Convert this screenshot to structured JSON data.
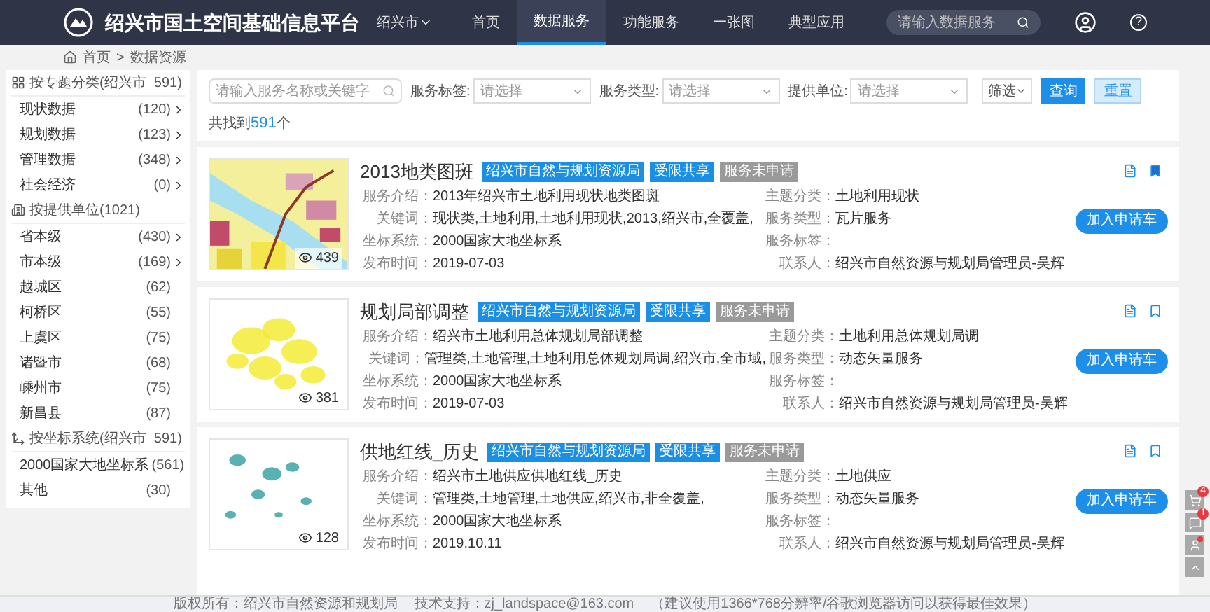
{
  "header": {
    "title": "绍兴市国土空间基础信息平台",
    "city": "绍兴市",
    "nav": [
      {
        "label": "首页",
        "selected": false
      },
      {
        "label": "数据服务",
        "selected": true
      },
      {
        "label": "功能服务",
        "selected": false
      },
      {
        "label": "一张图",
        "selected": false
      },
      {
        "label": "典型应用",
        "selected": false
      }
    ],
    "search": {
      "placeholder": "请输入数据服务"
    },
    "help": "?"
  },
  "breadcrumb": {
    "items": [
      "首页",
      "数据资源"
    ],
    "separator": ">"
  },
  "sidebar": {
    "groups": [
      {
        "kind": "grid",
        "title": "按专题分类(绍兴市  591)",
        "items": [
          {
            "label": "现状数据",
            "count": "(120)",
            "expandable": true
          },
          {
            "label": "规划数据",
            "count": "(123)",
            "expandable": true
          },
          {
            "label": "管理数据",
            "count": "(348)",
            "expandable": true
          },
          {
            "label": "社会经济",
            "count": "(0)",
            "expandable": true
          }
        ]
      },
      {
        "kind": "building",
        "title": "按提供单位(1021)",
        "items": [
          {
            "label": "省本级",
            "count": "(430)",
            "expandable": true
          },
          {
            "label": "市本级",
            "count": "(169)",
            "expandable": true
          },
          {
            "label": "越城区",
            "count": "(62)",
            "expandable": false
          },
          {
            "label": "柯桥区",
            "count": "(55)",
            "expandable": false
          },
          {
            "label": "上虞区",
            "count": "(75)",
            "expandable": false
          },
          {
            "label": "诸暨市",
            "count": "(68)",
            "expandable": false
          },
          {
            "label": "嵊州市",
            "count": "(75)",
            "expandable": false
          },
          {
            "label": "新昌县",
            "count": "(87)",
            "expandable": false
          }
        ]
      },
      {
        "kind": "axis",
        "title": "按坐标系统(绍兴市  591)",
        "items": [
          {
            "label": "2000国家大地坐标系",
            "count": "(561)",
            "expandable": false
          },
          {
            "label": "其他",
            "count": "(30)",
            "expandable": false
          }
        ]
      }
    ]
  },
  "filter": {
    "search_placeholder": "请输入服务名称或关键字",
    "selects": [
      {
        "label": "服务标签:",
        "placeholder": "请选择"
      },
      {
        "label": "服务类型:",
        "placeholder": "请选择"
      },
      {
        "label": "提供单位:",
        "placeholder": "请选择"
      }
    ],
    "screen_button": "筛选",
    "query_button": "查询",
    "reset_button": "重置"
  },
  "result_count": {
    "prefix": "共找到",
    "count": "591",
    "suffix": "个"
  },
  "cards": [
    {
      "title": "2013地类图斑",
      "badges": [
        {
          "text": "绍兴市自然与规划资源局",
          "kind": "org"
        },
        {
          "text": "受限共享",
          "kind": "share"
        },
        {
          "text": "服务未申请",
          "kind": "status"
        }
      ],
      "views": "439",
      "bookmarked": true,
      "fields_left": [
        {
          "label": "服务介绍：",
          "value": "2013年绍兴市土地利用现状地类图斑"
        },
        {
          "label": "关键词：",
          "value": "现状类,土地利用,土地利用现状,2013,绍兴市,全覆盖,"
        },
        {
          "label": "坐标系统：",
          "value": "2000国家大地坐标系"
        },
        {
          "label": "发布时间：",
          "value": "2019-07-03"
        }
      ],
      "fields_right": [
        {
          "label": "主题分类：",
          "value": "土地利用现状"
        },
        {
          "label": "服务类型：",
          "value": "瓦片服务"
        },
        {
          "label": "服务标签："
        },
        {
          "label": "联系人：",
          "value": "绍兴市自然资源与规划局管理员-吴辉"
        }
      ],
      "button": "加入申请车"
    },
    {
      "title": "规划局部调整",
      "badges": [
        {
          "text": "绍兴市自然与规划资源局",
          "kind": "org"
        },
        {
          "text": "受限共享",
          "kind": "share"
        },
        {
          "text": "服务未申请",
          "kind": "status"
        }
      ],
      "views": "381",
      "bookmarked": false,
      "fields_left": [
        {
          "label": "服务介绍：",
          "value": "绍兴市土地利用总体规划局部调整"
        },
        {
          "label": "关键词：",
          "value": "管理类,土地管理,土地利用总体规划局调,绍兴市,全市域,"
        },
        {
          "label": "坐标系统：",
          "value": "2000国家大地坐标系"
        },
        {
          "label": "发布时间：",
          "value": "2019-07-03"
        }
      ],
      "fields_right": [
        {
          "label": "主题分类：",
          "value": "土地利用总体规划局调"
        },
        {
          "label": "服务类型：",
          "value": "动态矢量服务"
        },
        {
          "label": "服务标签："
        },
        {
          "label": "联系人：",
          "value": "绍兴市自然资源与规划局管理员-吴辉"
        }
      ],
      "button": "加入申请车"
    },
    {
      "title": "供地红线_历史",
      "badges": [
        {
          "text": "绍兴市自然与规划资源局",
          "kind": "org"
        },
        {
          "text": "受限共享",
          "kind": "share"
        },
        {
          "text": "服务未申请",
          "kind": "status"
        }
      ],
      "views": "128",
      "bookmarked": false,
      "fields_left": [
        {
          "label": "服务介绍：",
          "value": "绍兴市土地供应供地红线_历史"
        },
        {
          "label": "关键词：",
          "value": "管理类,土地管理,土地供应,绍兴市,非全覆盖,"
        },
        {
          "label": "坐标系统：",
          "value": "2000国家大地坐标系"
        },
        {
          "label": "发布时间：",
          "value": "2019.10.11"
        }
      ],
      "fields_right": [
        {
          "label": "主题分类：",
          "value": "土地供应"
        },
        {
          "label": "服务类型：",
          "value": "动态矢量服务"
        },
        {
          "label": "服务标签："
        },
        {
          "label": "联系人：",
          "value": "绍兴市自然资源与规划局管理员-吴辉"
        }
      ],
      "button": "加入申请车"
    }
  ],
  "float_buttons": [
    {
      "kind": "cart",
      "badge": "4",
      "alert": false
    },
    {
      "kind": "message",
      "badge": "1",
      "alert": false
    },
    {
      "kind": "user",
      "alert": true
    },
    {
      "kind": "top",
      "alert": false
    }
  ],
  "footer": [
    "版权所有：绍兴市自然资源和规划局",
    "技术支持：zj_landspace@163.com",
    "（建议使用1366*768分辨率/谷歌浏览器访问以获得最佳效果）"
  ]
}
